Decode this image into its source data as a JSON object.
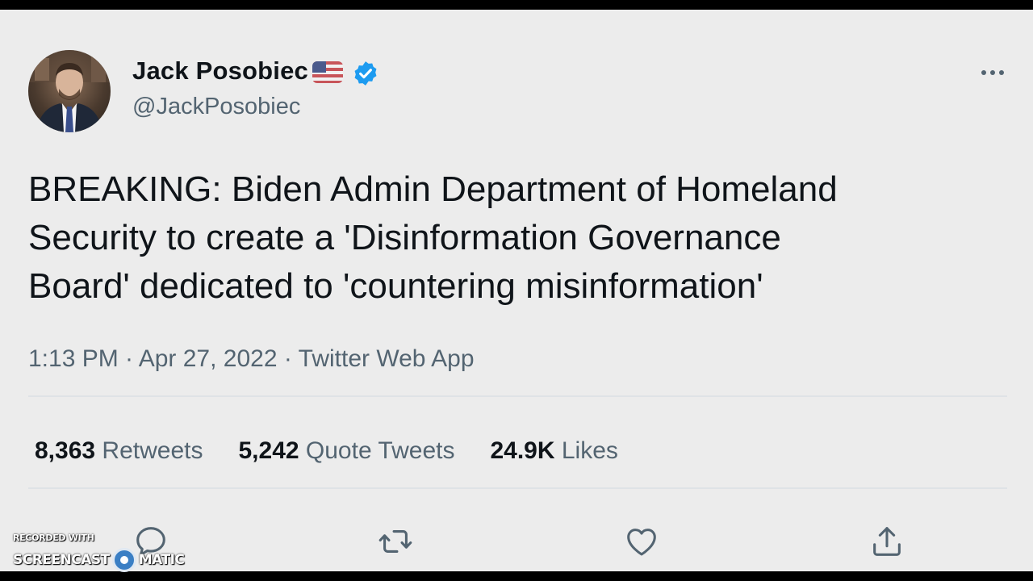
{
  "author": {
    "display_name": "Jack Posobiec",
    "handle": "@JackPosobiec"
  },
  "tweet": {
    "text_lines": [
      "BREAKING: Biden Admin Department of Homeland",
      "Security to create a 'Disinformation Governance",
      "Board' dedicated to 'countering misinformation'"
    ],
    "meta": "1:13 PM · Apr 27, 2022 · Twitter Web App"
  },
  "stats": {
    "retweets": {
      "count": "8,363",
      "label": "Retweets"
    },
    "quote_tweets": {
      "count": "5,242",
      "label": "Quote Tweets"
    },
    "likes": {
      "count": "24.9K",
      "label": "Likes"
    }
  },
  "actions": [
    "reply-icon",
    "retweet-icon",
    "like-icon",
    "share-icon"
  ],
  "watermark": {
    "top": "RECORDED WITH",
    "left": "SCREENCAST",
    "right": "MATIC"
  },
  "colors": {
    "background": "#ececec",
    "text": "#0f1419",
    "secondary_text": "#536471",
    "verified_blue": "#1d9bf0"
  }
}
